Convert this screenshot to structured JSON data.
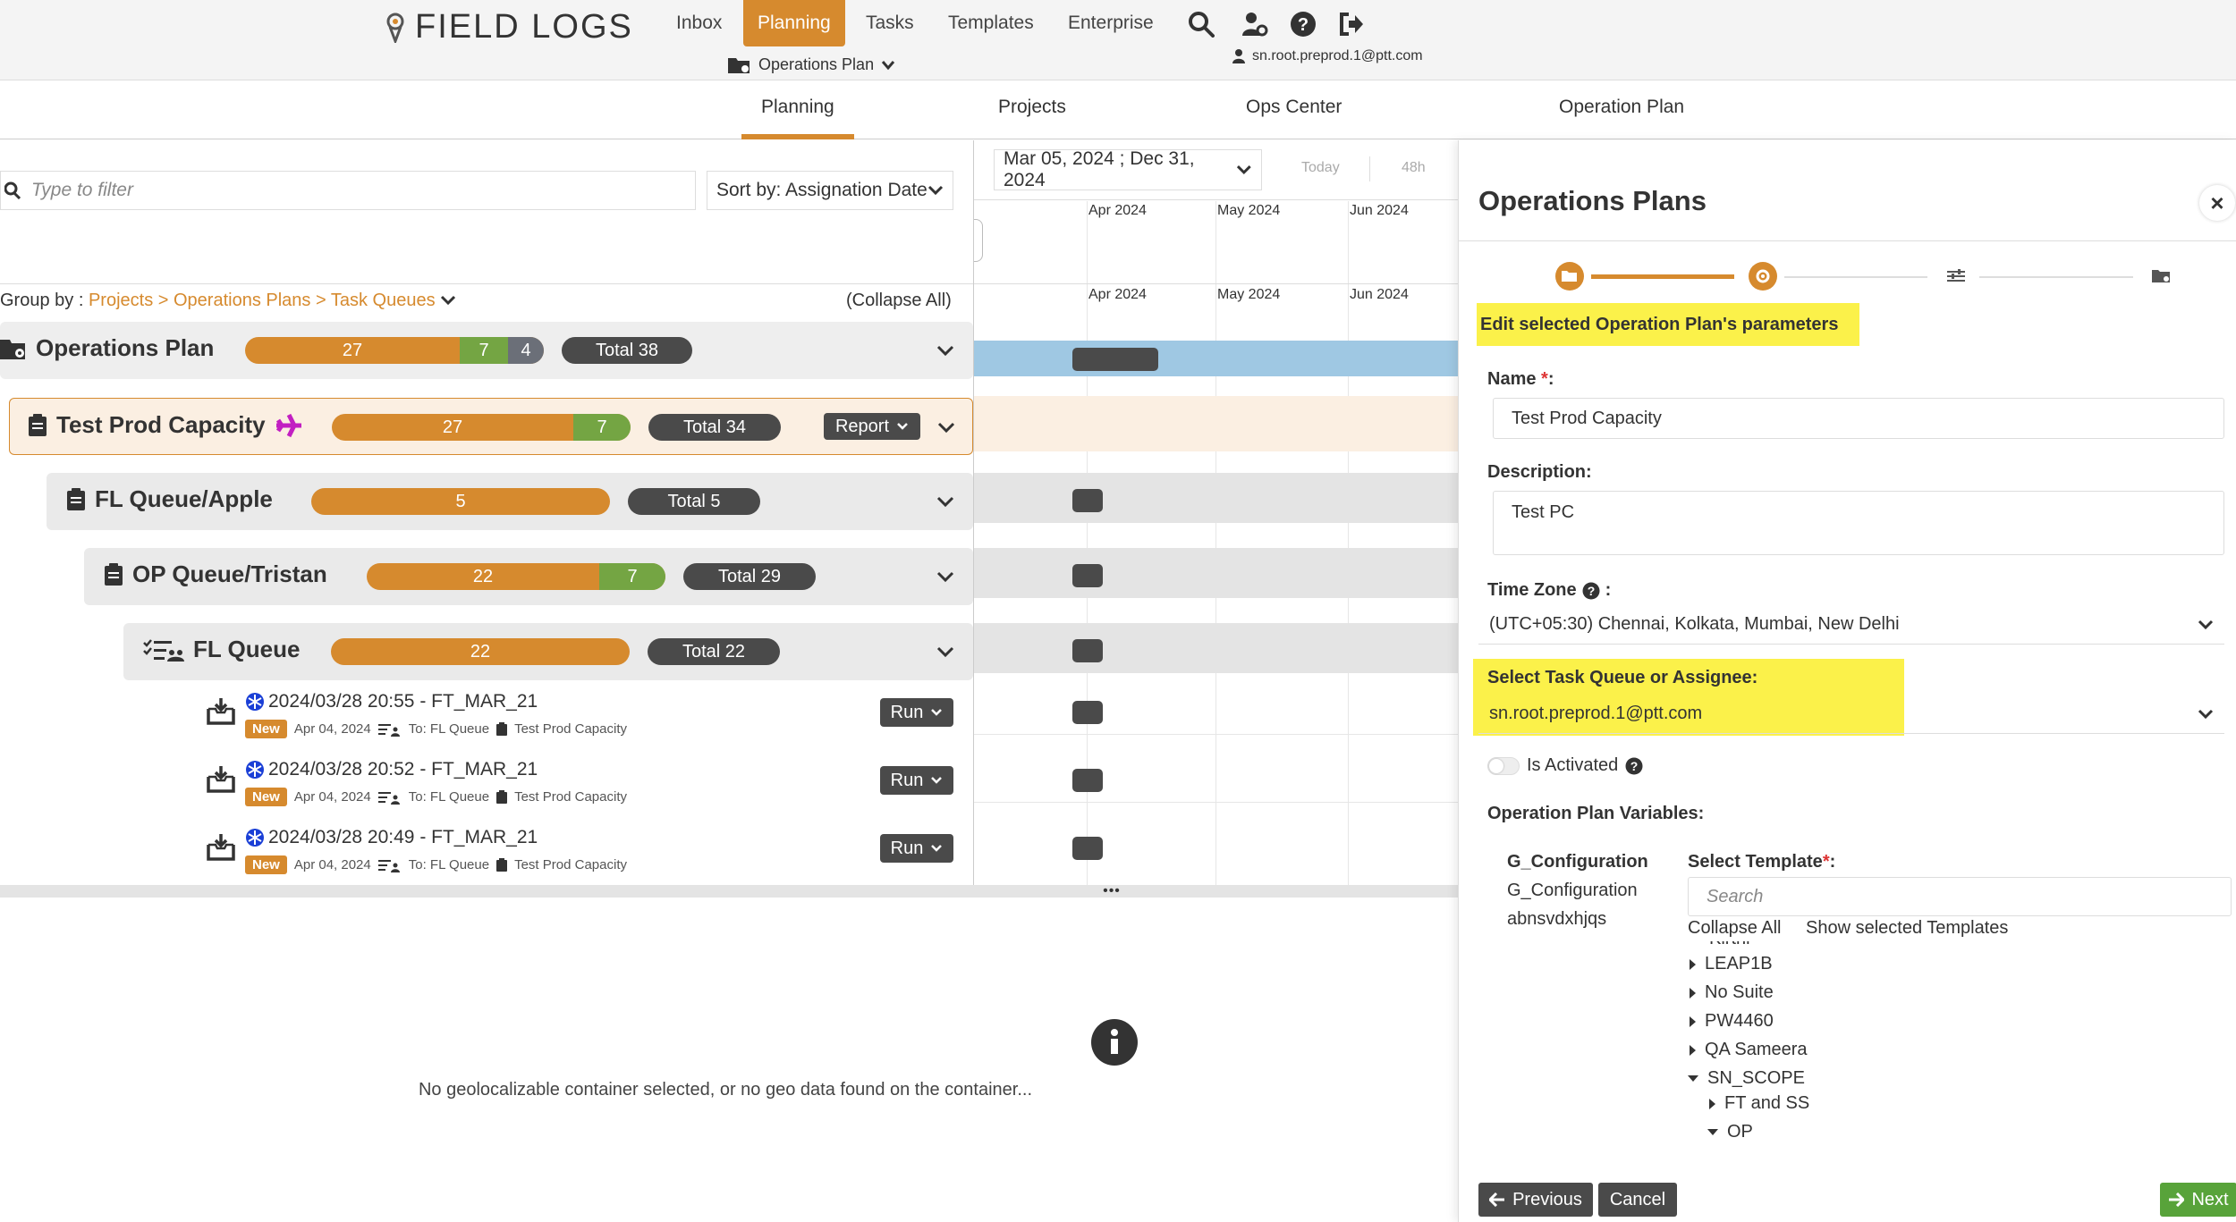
{
  "header": {
    "logo_text": "FIELD LOGS",
    "nav": [
      "Inbox",
      "Planning",
      "Tasks",
      "Templates",
      "Enterprise"
    ],
    "active_nav": "Planning",
    "context_dropdown": "Operations Plan",
    "user_email": "sn.root.preprod.1@ptt.com"
  },
  "tabs": [
    "Planning",
    "Projects",
    "Ops Center",
    "Operation Plan"
  ],
  "left": {
    "filter_placeholder": "Type to filter",
    "sort_label": "Sort by: Assignation Date",
    "group_by_label": "Group by :",
    "group_by_path": "Projects > Operations Plans > Task Queues",
    "collapse_all": "(Collapse All)",
    "rows": [
      {
        "title": "Operations Plan",
        "seg1": "27",
        "seg2": "7",
        "seg3": "4",
        "total": "Total 38"
      },
      {
        "title": "Test Prod Capacity",
        "seg1": "27",
        "seg2": "7",
        "total": "Total 34",
        "action": "Report"
      },
      {
        "title": "FL Queue/Apple",
        "seg1": "5",
        "total": "Total 5"
      },
      {
        "title": "OP Queue/Tristan",
        "seg1": "22",
        "seg2": "7",
        "total": "Total 29"
      },
      {
        "title": "FL Queue",
        "seg1": "22",
        "total": "Total 22"
      }
    ],
    "tasks": [
      {
        "title": "2024/03/28 20:55 - FT_MAR_21",
        "badge": "New",
        "date": "Apr 04, 2024",
        "to": "To: FL Queue",
        "project": "Test Prod Capacity",
        "action": "Run"
      },
      {
        "title": "2024/03/28 20:52 - FT_MAR_21",
        "badge": "New",
        "date": "Apr 04, 2024",
        "to": "To: FL Queue",
        "project": "Test Prod Capacity",
        "action": "Run"
      },
      {
        "title": "2024/03/28 20:49 - FT_MAR_21",
        "badge": "New",
        "date": "Apr 04, 2024",
        "to": "To: FL Queue",
        "project": "Test Prod Capacity",
        "action": "Run"
      }
    ]
  },
  "gantt": {
    "date_range": "Mar 05, 2024 ; Dec 31, 2024",
    "quick_today": "Today",
    "quick_48h": "48h",
    "months": [
      "Apr 2024",
      "May 2024",
      "Jun 2024"
    ]
  },
  "bottom": {
    "message": "No geolocalizable container selected, or no geo data found on the container..."
  },
  "panel": {
    "title": "Operations Plans",
    "step_heading": "Edit selected Operation Plan's parameters",
    "name_label": "Name",
    "name_value": "Test Prod Capacity",
    "description_label": "Description:",
    "description_value": "Test PC",
    "timezone_label": "Time Zone",
    "timezone_value": "(UTC+05:30) Chennai, Kolkata, Mumbai, New Delhi",
    "assignee_label": "Select Task Queue or Assignee:",
    "assignee_value": "sn.root.preprod.1@ptt.com",
    "activated_label": "Is Activated",
    "variables_label": "Operation Plan Variables:",
    "var_name": "G_Configuration",
    "var_values": [
      "G_Configuration",
      "abnsvdxhjqs"
    ],
    "template_label": "Select Template",
    "template_search_placeholder": "Search",
    "collapse_all": "Collapse All",
    "show_selected": "Show selected Templates",
    "tree_partial": "Kirthi",
    "tree": [
      {
        "label": "LEAP1B",
        "open": false,
        "level": 0
      },
      {
        "label": "No Suite",
        "open": false,
        "level": 0
      },
      {
        "label": "PW4460",
        "open": false,
        "level": 0
      },
      {
        "label": "QA Sameera",
        "open": false,
        "level": 0
      },
      {
        "label": "SN_SCOPE",
        "open": true,
        "level": 0
      },
      {
        "label": "FT and SS",
        "open": false,
        "level": 1
      },
      {
        "label": "OP",
        "open": true,
        "level": 1
      }
    ],
    "prev_button": "Previous",
    "cancel_button": "Cancel",
    "next_button": "Next"
  },
  "colors": {
    "accent": "#d68a2e",
    "green": "#74a543",
    "grey_segment": "#6b6f78",
    "dark": "#4a4a4a",
    "highlight": "#fbf14a",
    "gantt_blue": "#9fc8e3",
    "selected_row": "#fbefe2",
    "next_green": "#58a33a"
  }
}
